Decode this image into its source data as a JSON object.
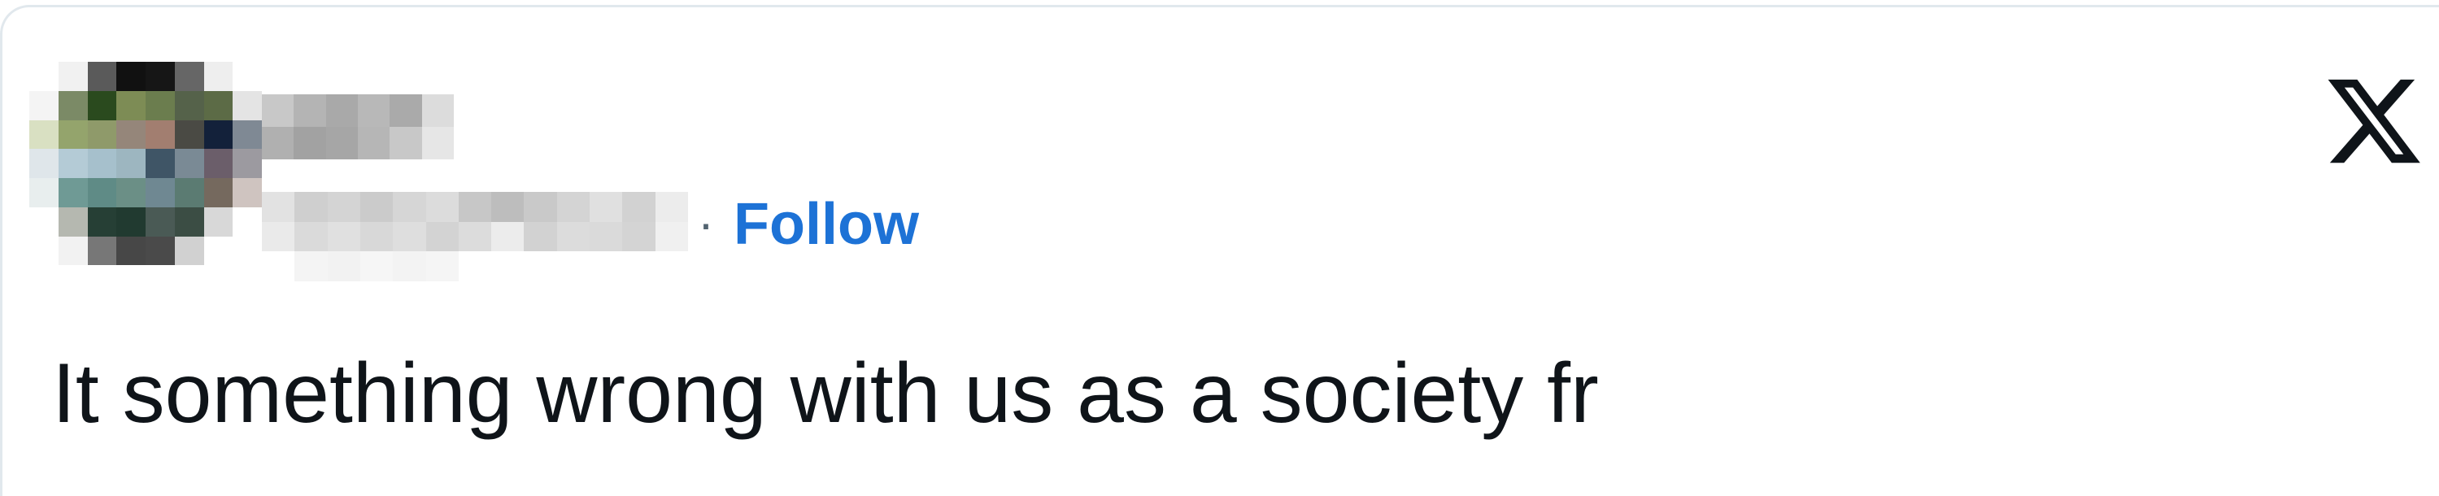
{
  "tweet": {
    "separator": "·",
    "follow_label": "Follow",
    "text": "It something wrong with us as a society fr"
  },
  "author": {
    "avatar_icon": "pixelated-avatar",
    "name_redacted": true,
    "handle_redacted": true
  },
  "brand": {
    "logo_icon": "x-logo-icon",
    "follow_color": "#1d72d6",
    "text_color": "#0f1419"
  }
}
